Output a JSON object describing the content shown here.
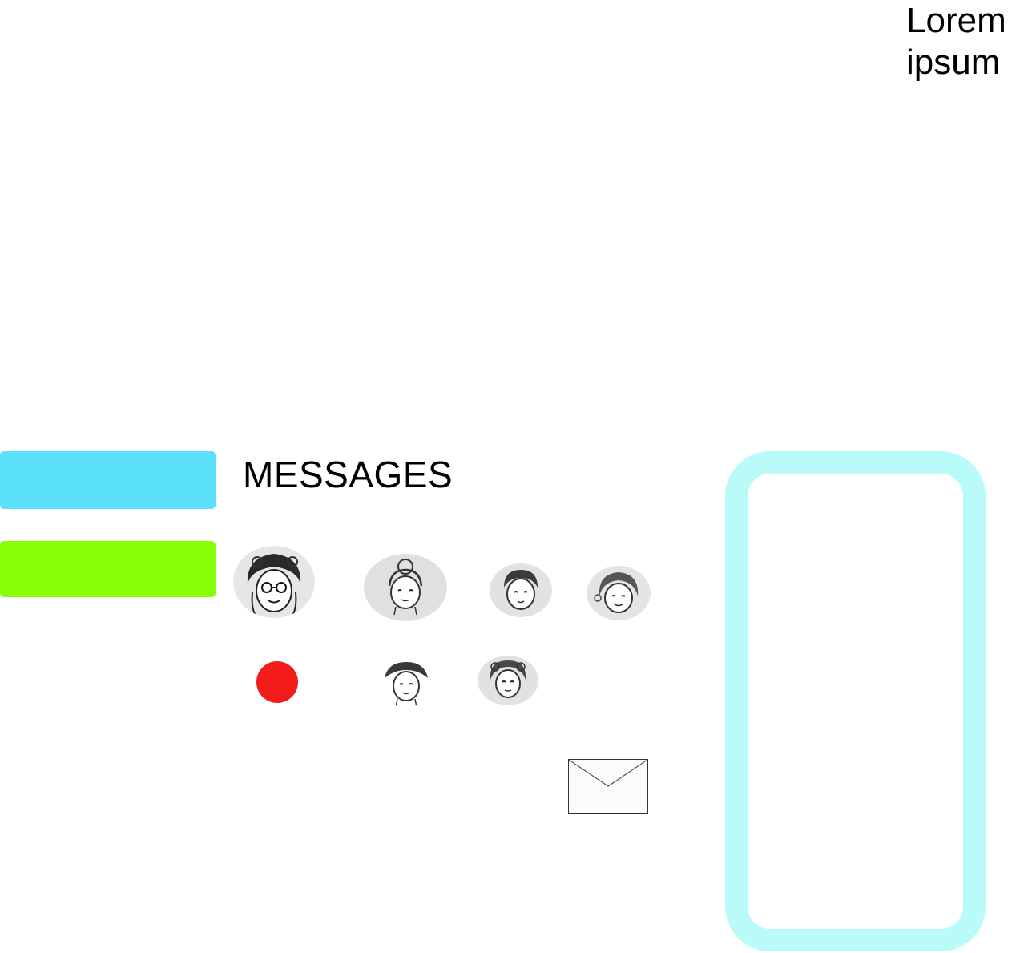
{
  "header": {
    "corner_text_line1": "Lorem",
    "corner_text_line2": "ipsum"
  },
  "sidebar": {
    "bars": [
      {
        "name": "blue-bar",
        "color": "#5ce1fc"
      },
      {
        "name": "green-bar",
        "color": "#88ff06"
      }
    ]
  },
  "messages": {
    "title": "MESSAGES",
    "contacts": [
      {
        "icon": "avatar-girl-glasses-icon"
      },
      {
        "icon": "avatar-girl-bun-icon"
      },
      {
        "icon": "avatar-boy-icon"
      },
      {
        "icon": "avatar-smiling-girl-icon"
      },
      {
        "icon": "avatar-boy-cap-icon"
      },
      {
        "icon": "avatar-curly-hair-icon"
      }
    ],
    "status_dot_color": "#f41b1b",
    "compose_icon": "envelope-icon"
  },
  "phone_preview": {
    "frame_color": "#b8fbf8"
  }
}
